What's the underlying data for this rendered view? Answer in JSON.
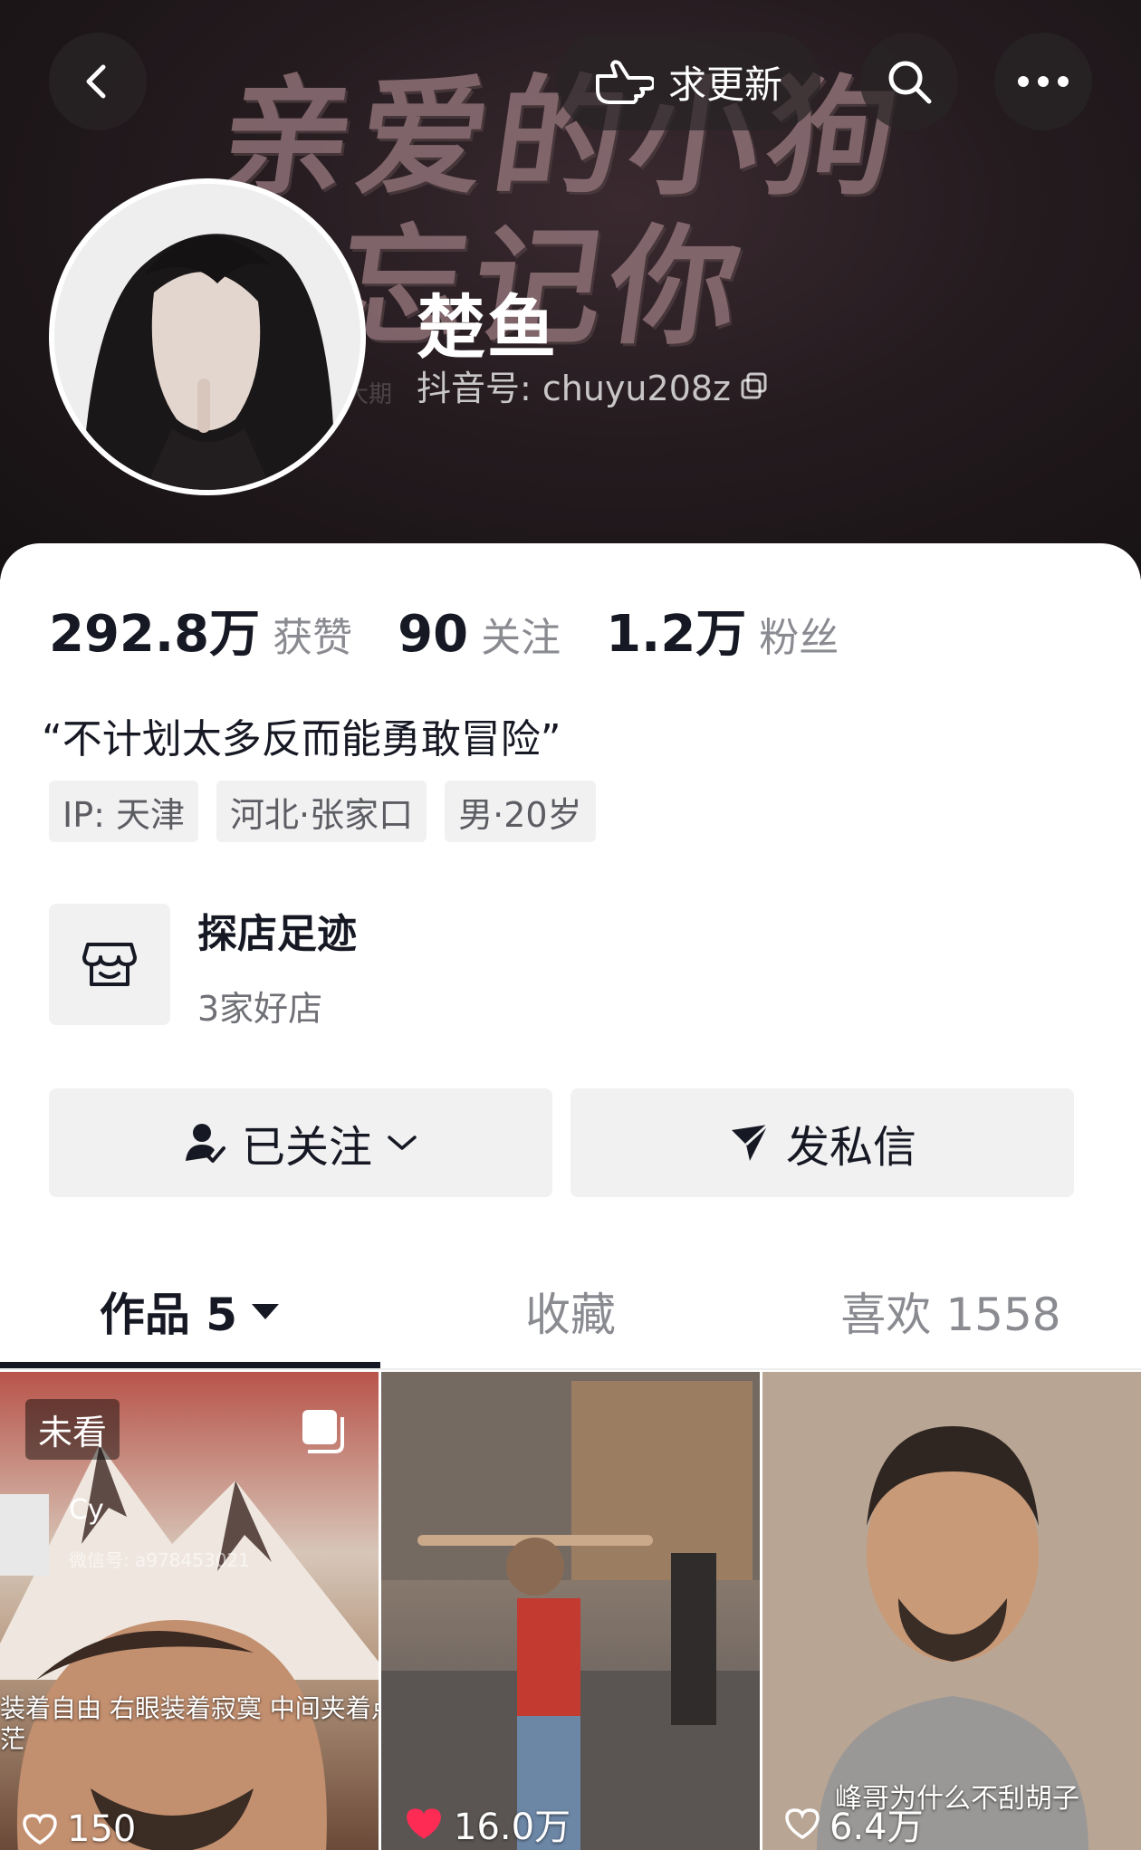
{
  "header": {
    "request_update_label": "求更新",
    "banner_text_line1": "亲爱的小狗",
    "banner_text_line2": "没忘记你",
    "banner_faint_text": "丫大期"
  },
  "profile": {
    "name": "楚鱼",
    "douyin_id": "抖音号: chuyu208z",
    "stats": [
      {
        "value": "292.8万",
        "label": "获赞"
      },
      {
        "value": "90",
        "label": "关注"
      },
      {
        "value": "1.2万",
        "label": "粉丝"
      }
    ],
    "bio": "“不计划太多反而能勇敢冒险”",
    "tags": [
      "IP:  天津",
      "河北·张家口",
      "男·20岁"
    ]
  },
  "shop": {
    "title": "探店足迹",
    "subtitle": "3家好店"
  },
  "actions": {
    "follow_label": "已关注",
    "message_label": "发私信"
  },
  "tabs": {
    "works": "作品 5",
    "favorites": "收藏",
    "likes": "喜欢 1558"
  },
  "videos": [
    {
      "unwatched": "未看",
      "watermark_name": "Cy",
      "watermark_id": "微信号: a978453021",
      "caption_line1": "装着自由 右眼装着寂寞 中间夹着点对真",
      "caption_line2": "茫",
      "likes": "150"
    },
    {
      "likes": "16.0万"
    },
    {
      "caption": "峰哥为什么不刮胡子",
      "likes": "6.4万"
    }
  ]
}
